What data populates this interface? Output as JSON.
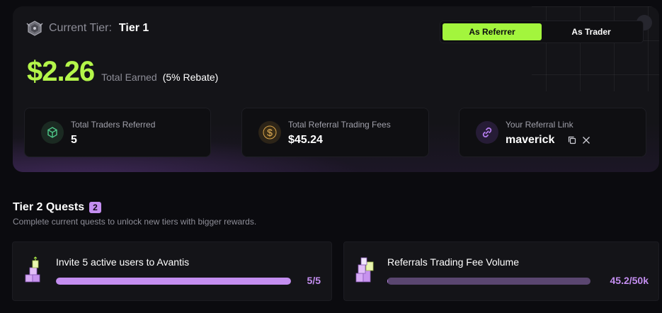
{
  "tier": {
    "label": "Current Tier:",
    "value": "Tier 1",
    "icon": "tier-badge-icon"
  },
  "toggle": {
    "options": [
      {
        "label": "As Referrer",
        "active": true
      },
      {
        "label": "As Trader",
        "active": false
      }
    ]
  },
  "earnings": {
    "amount": "$2.26",
    "label": "Total Earned",
    "rebate": "(5% Rebate)"
  },
  "stats": [
    {
      "label": "Total Traders Referred",
      "value": "5",
      "icon": "cube-icon"
    },
    {
      "label": "Total Referral Trading Fees",
      "value": "$45.24",
      "icon": "dollar-icon"
    },
    {
      "label": "Your Referral Link",
      "value": "maverick",
      "icon": "link-icon"
    }
  ],
  "quests": {
    "title": "Tier 2 Quests",
    "count": "2",
    "subtitle": "Complete current quests to unlock new tiers with bigger rewards.",
    "items": [
      {
        "title": "Invite 5 active users to Avantis",
        "progress_text": "5/5",
        "progress_fraction": 1.0,
        "icon": "stacked-blocks-icon"
      },
      {
        "title": "Referrals Trading Fee Volume",
        "progress_text": "45.2/50k",
        "progress_fraction": 0.0009,
        "icon": "stacked-blocks-icon"
      }
    ]
  },
  "colors": {
    "accent_green": "#b4f64a",
    "toggle_active": "#a3f53d",
    "accent_purple": "#c48ef0",
    "bar_track": "#3a2e4a",
    "background": "#0b0b0f"
  }
}
